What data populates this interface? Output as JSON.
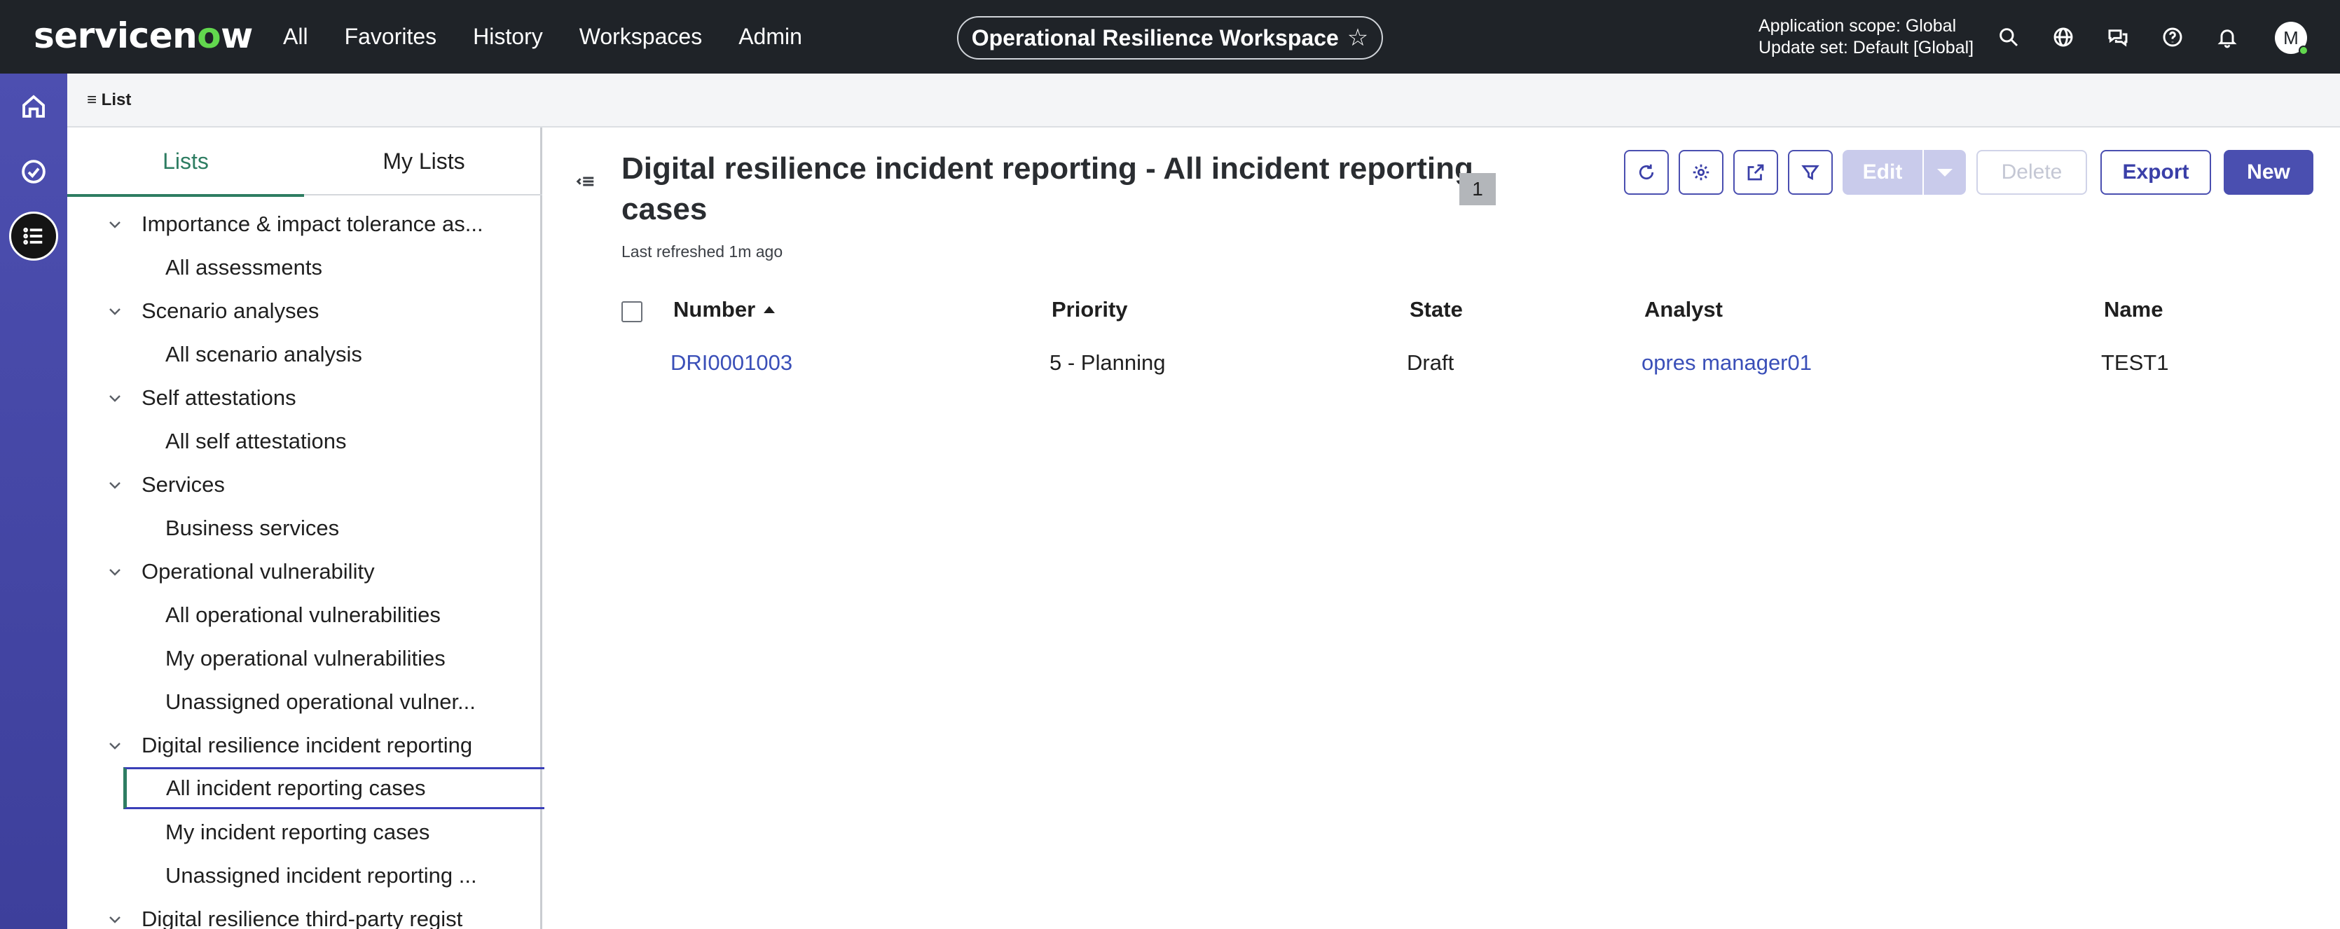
{
  "topbar": {
    "logo_text_pre": "servicen",
    "logo_text_o": "o",
    "logo_text_post": "w",
    "nav": [
      "All",
      "Favorites",
      "History",
      "Workspaces",
      "Admin"
    ],
    "workspace": "Operational Resilience Workspace",
    "scope_line1": "Application scope: Global",
    "scope_line2": "Update set: Default [Global]",
    "avatar_initial": "M"
  },
  "subheader": {
    "label": "≡ List"
  },
  "lists_panel": {
    "tabs": [
      "Lists",
      "My Lists"
    ],
    "active_tab": "Lists",
    "groups": [
      {
        "label": "Importance & impact tolerance as...",
        "items": [
          "All assessments"
        ]
      },
      {
        "label": "Scenario analyses",
        "items": [
          "All scenario analysis"
        ]
      },
      {
        "label": "Self attestations",
        "items": [
          "All self attestations"
        ]
      },
      {
        "label": "Services",
        "items": [
          "Business services"
        ]
      },
      {
        "label": "Operational vulnerability",
        "items": [
          "All operational vulnerabilities",
          "My operational vulnerabilities",
          "Unassigned operational vulner..."
        ]
      },
      {
        "label": "Digital resilience incident reporting",
        "items": [
          "All incident reporting cases",
          "My incident reporting cases",
          "Unassigned incident reporting ..."
        ]
      },
      {
        "label": "Digital resilience third-party regist",
        "items": []
      }
    ],
    "selected_item": "All incident reporting cases"
  },
  "main": {
    "title": "Digital resilience incident reporting - All incident reporting cases",
    "count": "1",
    "refreshed": "Last refreshed 1m ago",
    "buttons": {
      "edit": "Edit",
      "delete": "Delete",
      "export": "Export",
      "new": "New"
    },
    "columns": [
      "Number",
      "Priority",
      "State",
      "Analyst",
      "Name"
    ],
    "sort_column": "Number",
    "rows": [
      {
        "number": "DRI0001003",
        "priority": "5 - Planning",
        "state": "Draft",
        "analyst": "opres manager01",
        "name": "TEST1"
      }
    ]
  }
}
